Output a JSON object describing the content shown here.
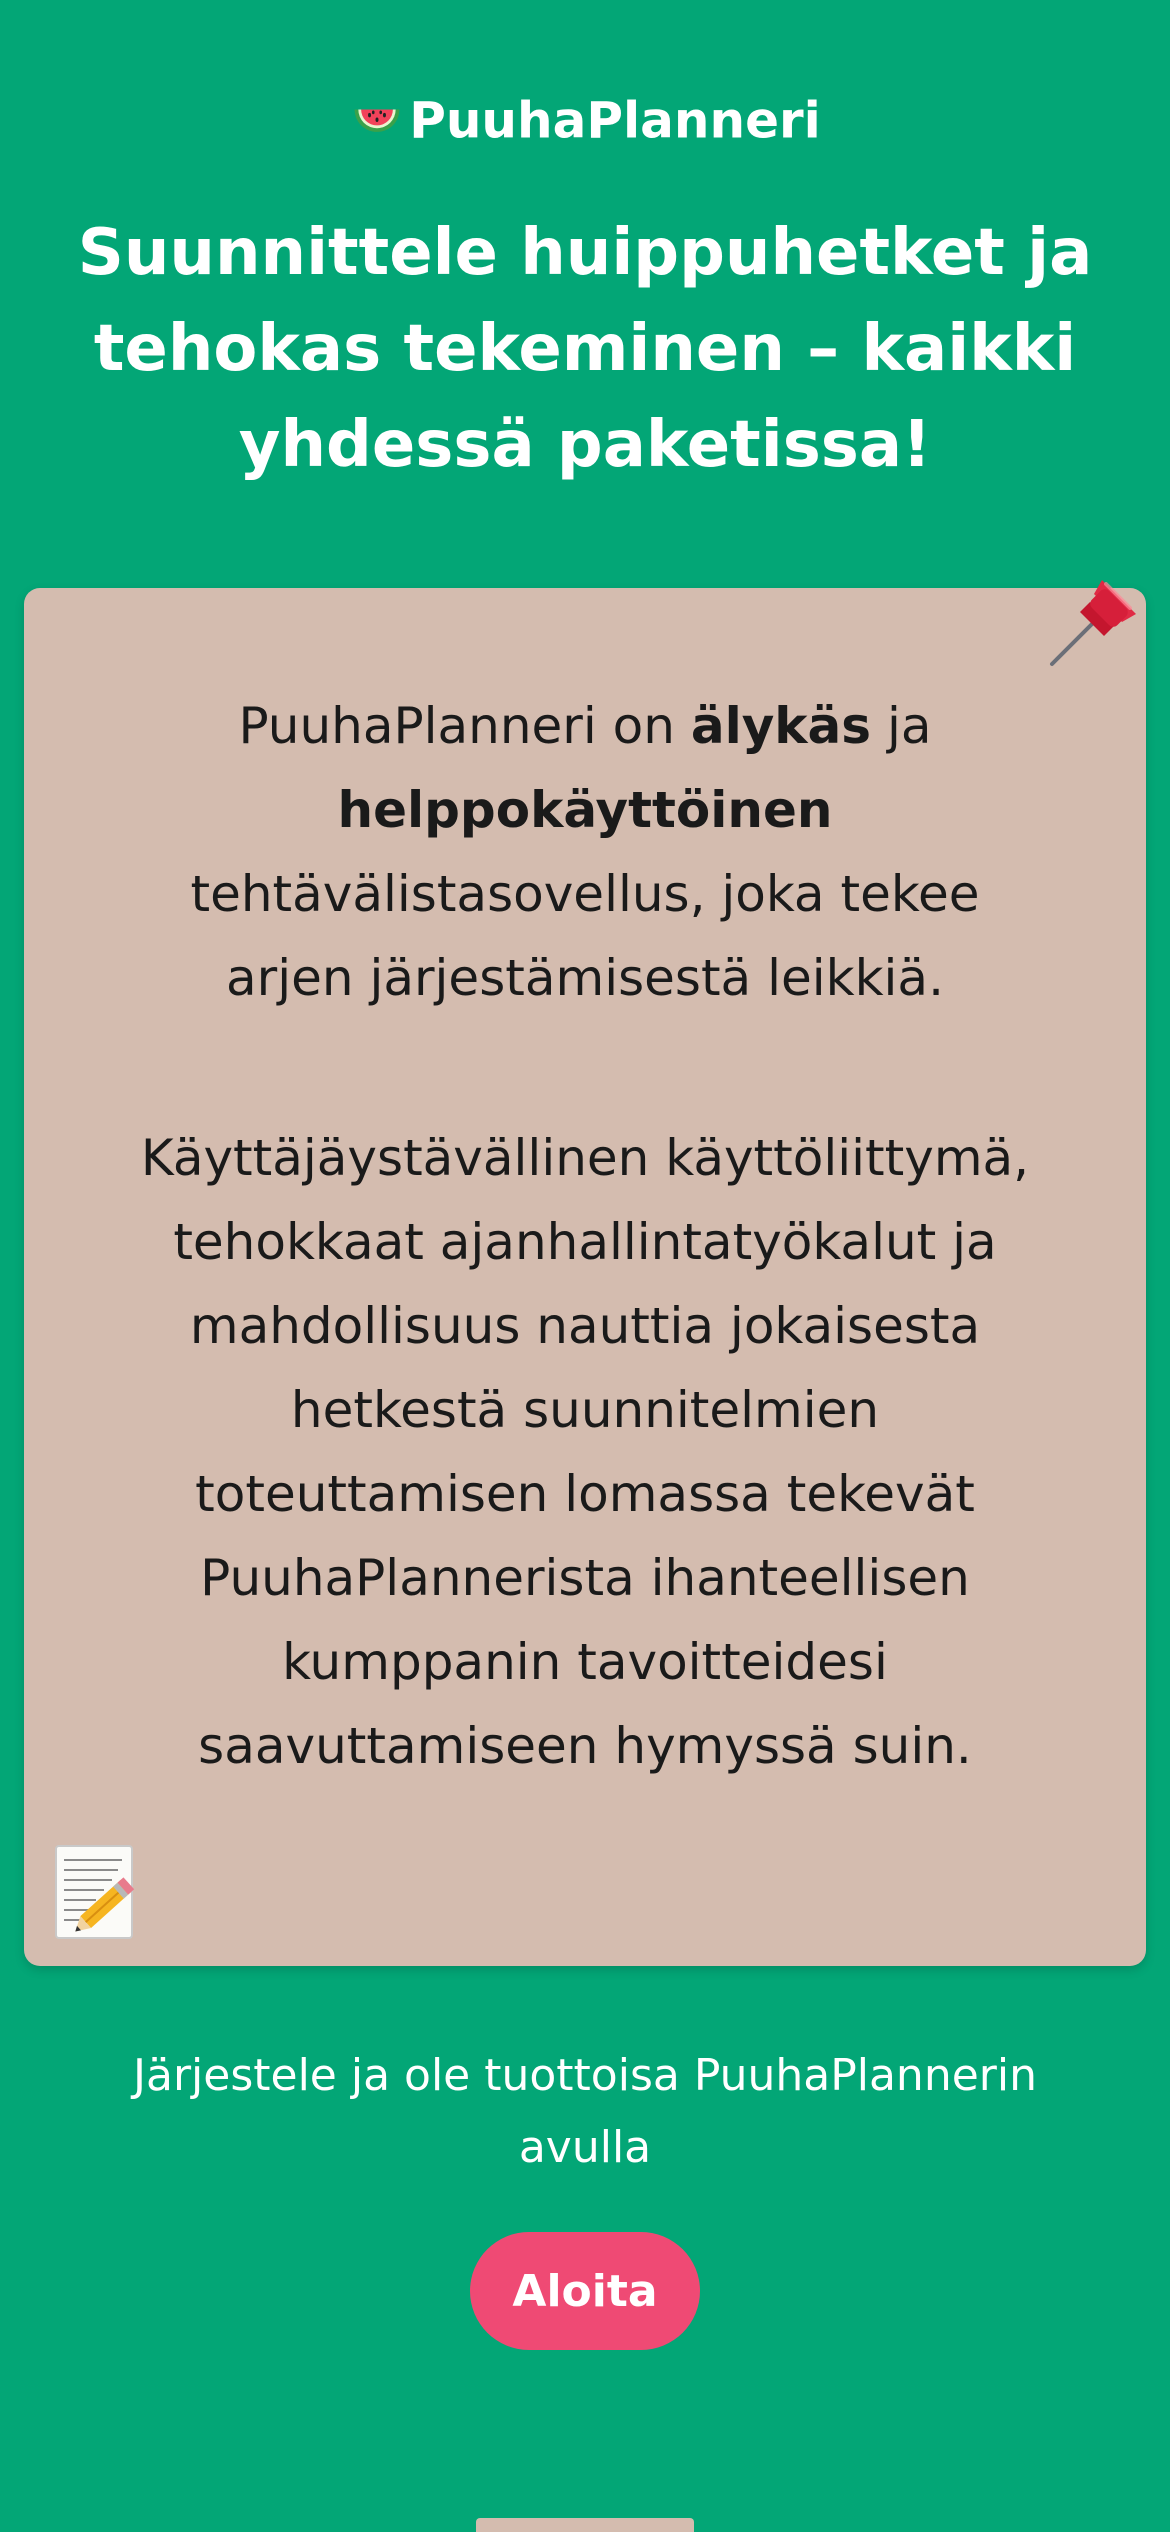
{
  "header": {
    "logo_icon": "watermelon-icon",
    "brand": "PuuhaPlanneri"
  },
  "hero": {
    "title": "Suunnittele huippuhetket ja tehokas tekeminen – kaikki yhdessä paketissa!"
  },
  "card": {
    "pin_icon": "pushpin-icon",
    "memo_icon": "memo-pencil-icon",
    "p1_prefix": "PuuhaPlanneri on ",
    "p1_bold1": "älykäs",
    "p1_mid": " ja ",
    "p1_bold2": "helppokäyttöinen",
    "p1_suffix": " tehtävälistasovellus, joka tekee arjen järjestämisestä leikkiä.",
    "p2": "Käyttäjäystävällinen käyttöliittymä, tehokkaat ajanhallintatyökalut ja mahdollisuus nauttia jokaisesta hetkestä suunnitelmien toteuttamisen lomassa tekevät PuuhaPlannerista ihanteellisen kumppanin tavoitteidesi saavuttamiseen hymyssä suin."
  },
  "tagline": "Järjestele ja ole tuottoisa PuuhaPlannerin avulla",
  "cta_label": "Aloita",
  "colors": {
    "background": "#03a676",
    "card": "#d4bcaf",
    "button": "#ef4a74",
    "text_light": "#ffffff",
    "text_dark": "#1a1a1a"
  }
}
